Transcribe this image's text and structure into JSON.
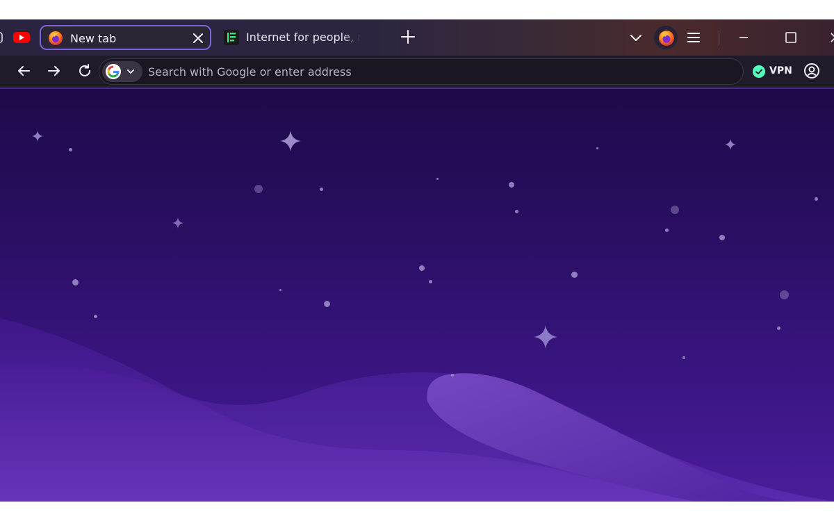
{
  "tabs": [
    {
      "title": "",
      "icon": "youtube-icon"
    },
    {
      "title": "New tab",
      "icon": "firefox-icon",
      "active": true
    },
    {
      "title": "Internet for people, not profit",
      "icon": "green-logo-icon"
    }
  ],
  "urlbar": {
    "placeholder": "Search with Google or enter address",
    "engine_icon": "google-icon"
  },
  "vpn": {
    "label": "VPN",
    "status": "connected",
    "status_color": "#54ffbd"
  },
  "colors": {
    "accent": "#7d63d8",
    "background_top": "#1e0a4a",
    "background_bottom": "#4a1d9a"
  }
}
